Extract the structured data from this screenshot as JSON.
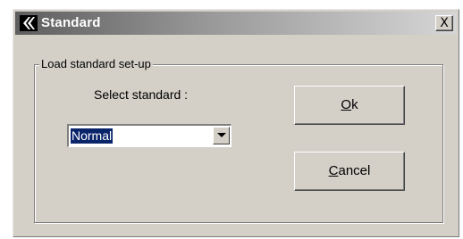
{
  "window": {
    "title": "Standard",
    "close_label": "X"
  },
  "group": {
    "legend": "Load standard set-up",
    "select_label": "Select standard :",
    "selected_value": "Normal"
  },
  "buttons": {
    "ok": {
      "mnemonic": "O",
      "rest": "k"
    },
    "cancel": {
      "mnemonic": "C",
      "rest": "ancel"
    }
  },
  "colors": {
    "face": "#d4d0c8",
    "selection": "#0a246a"
  }
}
